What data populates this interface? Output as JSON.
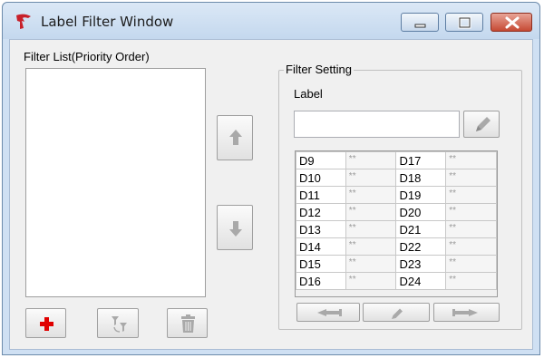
{
  "window": {
    "title": "Label Filter Window"
  },
  "left_panel": {
    "list_label": "Filter List(Priority Order)"
  },
  "filter_setting": {
    "group_title": "Filter Setting",
    "label_caption": "Label",
    "label_value": "",
    "rows": [
      {
        "left_name": "D9",
        "left_value": "**",
        "right_name": "D17",
        "right_value": "**"
      },
      {
        "left_name": "D10",
        "left_value": "**",
        "right_name": "D18",
        "right_value": "**"
      },
      {
        "left_name": "D11",
        "left_value": "**",
        "right_name": "D19",
        "right_value": "**"
      },
      {
        "left_name": "D12",
        "left_value": "**",
        "right_name": "D20",
        "right_value": "**"
      },
      {
        "left_name": "D13",
        "left_value": "**",
        "right_name": "D21",
        "right_value": "**"
      },
      {
        "left_name": "D14",
        "left_value": "**",
        "right_name": "D22",
        "right_value": "**"
      },
      {
        "left_name": "D15",
        "left_value": "**",
        "right_name": "D23",
        "right_value": "**"
      },
      {
        "left_name": "D16",
        "left_value": "**",
        "right_name": "D24",
        "right_value": "**"
      }
    ]
  },
  "icons": {
    "app": "app-logo-icon",
    "minimize": "minimize-icon",
    "maximize": "maximize-icon",
    "close": "close-icon",
    "move_up": "arrow-up-icon",
    "move_down": "arrow-down-icon",
    "add": "plus-icon",
    "filter": "filter-icon",
    "delete": "trash-icon",
    "edit_label": "pencil-icon",
    "scroll_left": "arrow-left-icon",
    "edit_cell": "pencil-icon",
    "scroll_right": "arrow-right-icon"
  },
  "colors": {
    "add_icon": "#e00000",
    "disabled_icon": "#a9a9a9",
    "title_bar": "#c4d8ee",
    "close_button": "#c64a34"
  }
}
